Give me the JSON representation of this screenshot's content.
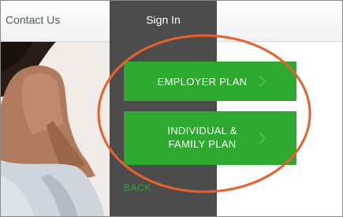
{
  "nav": {
    "contact_label": "Contact Us",
    "signin_label": "Sign In"
  },
  "menu": {
    "employer_label": "EMPLOYER PLAN",
    "individual_line1": "INDIVIDUAL &",
    "individual_line2": "FAMILY PLAN",
    "back_label": "BACK"
  },
  "colors": {
    "panel": "#4c4c4c",
    "button_green": "#2ea92f",
    "highlight_ring": "#e8602c"
  },
  "icons": {
    "chevron": "chevron-right-icon"
  }
}
